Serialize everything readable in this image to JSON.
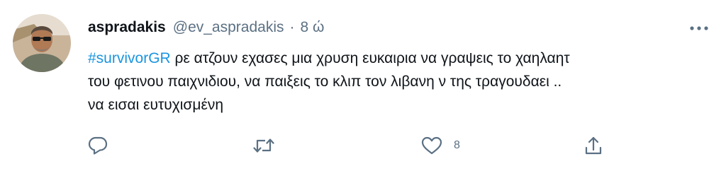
{
  "tweet": {
    "display_name": "aspradakis",
    "handle": "@ev_aspradakis",
    "separator": "·",
    "time": "8 ώ",
    "hashtag": "#survivorGR",
    "text_line1_rest": " ρε ατζουν εχασες μια χρυση ευκαιρια να γραψεις το χαηλαητ",
    "text_line2": "του φετινου παιχνιδιου, να παιξεις το κλιπ τον λιβανη ν της τραγουδαει ..",
    "text_line3": "να εισαι ευτυχισμένη",
    "like_count": "8"
  },
  "icons": {
    "more": "more-horizontal-icon",
    "reply": "reply-icon",
    "retweet": "retweet-icon",
    "like": "heart-icon",
    "share": "share-icon"
  },
  "colors": {
    "text": "#0f1419",
    "secondary": "#5b7083",
    "hashtag": "#1b95e0",
    "icon": "#5b7083"
  }
}
